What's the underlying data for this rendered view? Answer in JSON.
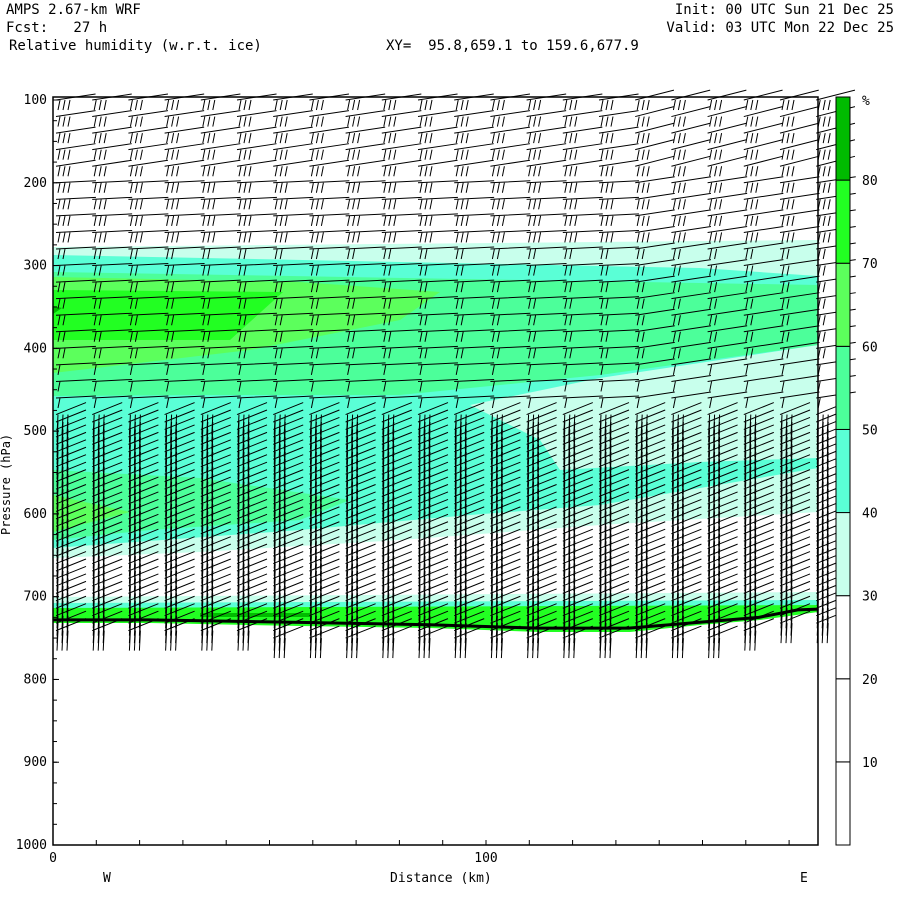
{
  "header": {
    "model": "AMPS 2.67-km WRF",
    "fcst": "Fcst:   27 h",
    "field": "Relative humidity (w.r.t. ice)",
    "xy": "XY=  95.8,659.1 to 159.6,677.9",
    "init": "Init: 00 UTC Sun 21 Dec 25",
    "valid": "Valid: 03 UTC Mon 22 Dec 25"
  },
  "chart_data": {
    "type": "heatmap",
    "title": "Relative humidity (w.r.t. ice)",
    "xlabel": "Distance (km)",
    "ylabel": "Pressure (hPa)",
    "xlim": [
      0,
      176.7
    ],
    "ylim": [
      1000,
      100
    ],
    "xticks": [
      "0",
      "100"
    ],
    "yticks": [
      "100",
      "200",
      "300",
      "400",
      "500",
      "600",
      "700",
      "800",
      "900",
      "1000"
    ],
    "west_label": "W",
    "east_label": "E",
    "colorbar": {
      "unit": "%",
      "levels": [
        "10",
        "20",
        "30",
        "40",
        "50",
        "60",
        "70",
        "80"
      ],
      "colors": [
        "#ffffff",
        "#ffffff",
        "#ffffff",
        "#c8ffec",
        "#5affd6",
        "#4cff9a",
        "#5cff5c",
        "#22ff22",
        "#00bb00"
      ]
    },
    "surface_pressure_hPa": [
      [
        0,
        728
      ],
      [
        22,
        728
      ],
      [
        57,
        731
      ],
      [
        87,
        734
      ],
      [
        112,
        738
      ],
      [
        133,
        738
      ],
      [
        149,
        731
      ],
      [
        163,
        725
      ],
      [
        172,
        716
      ],
      [
        176.7,
        715
      ]
    ],
    "wind_barbs": "westerly winds, stronger aloft and at mid levels"
  }
}
